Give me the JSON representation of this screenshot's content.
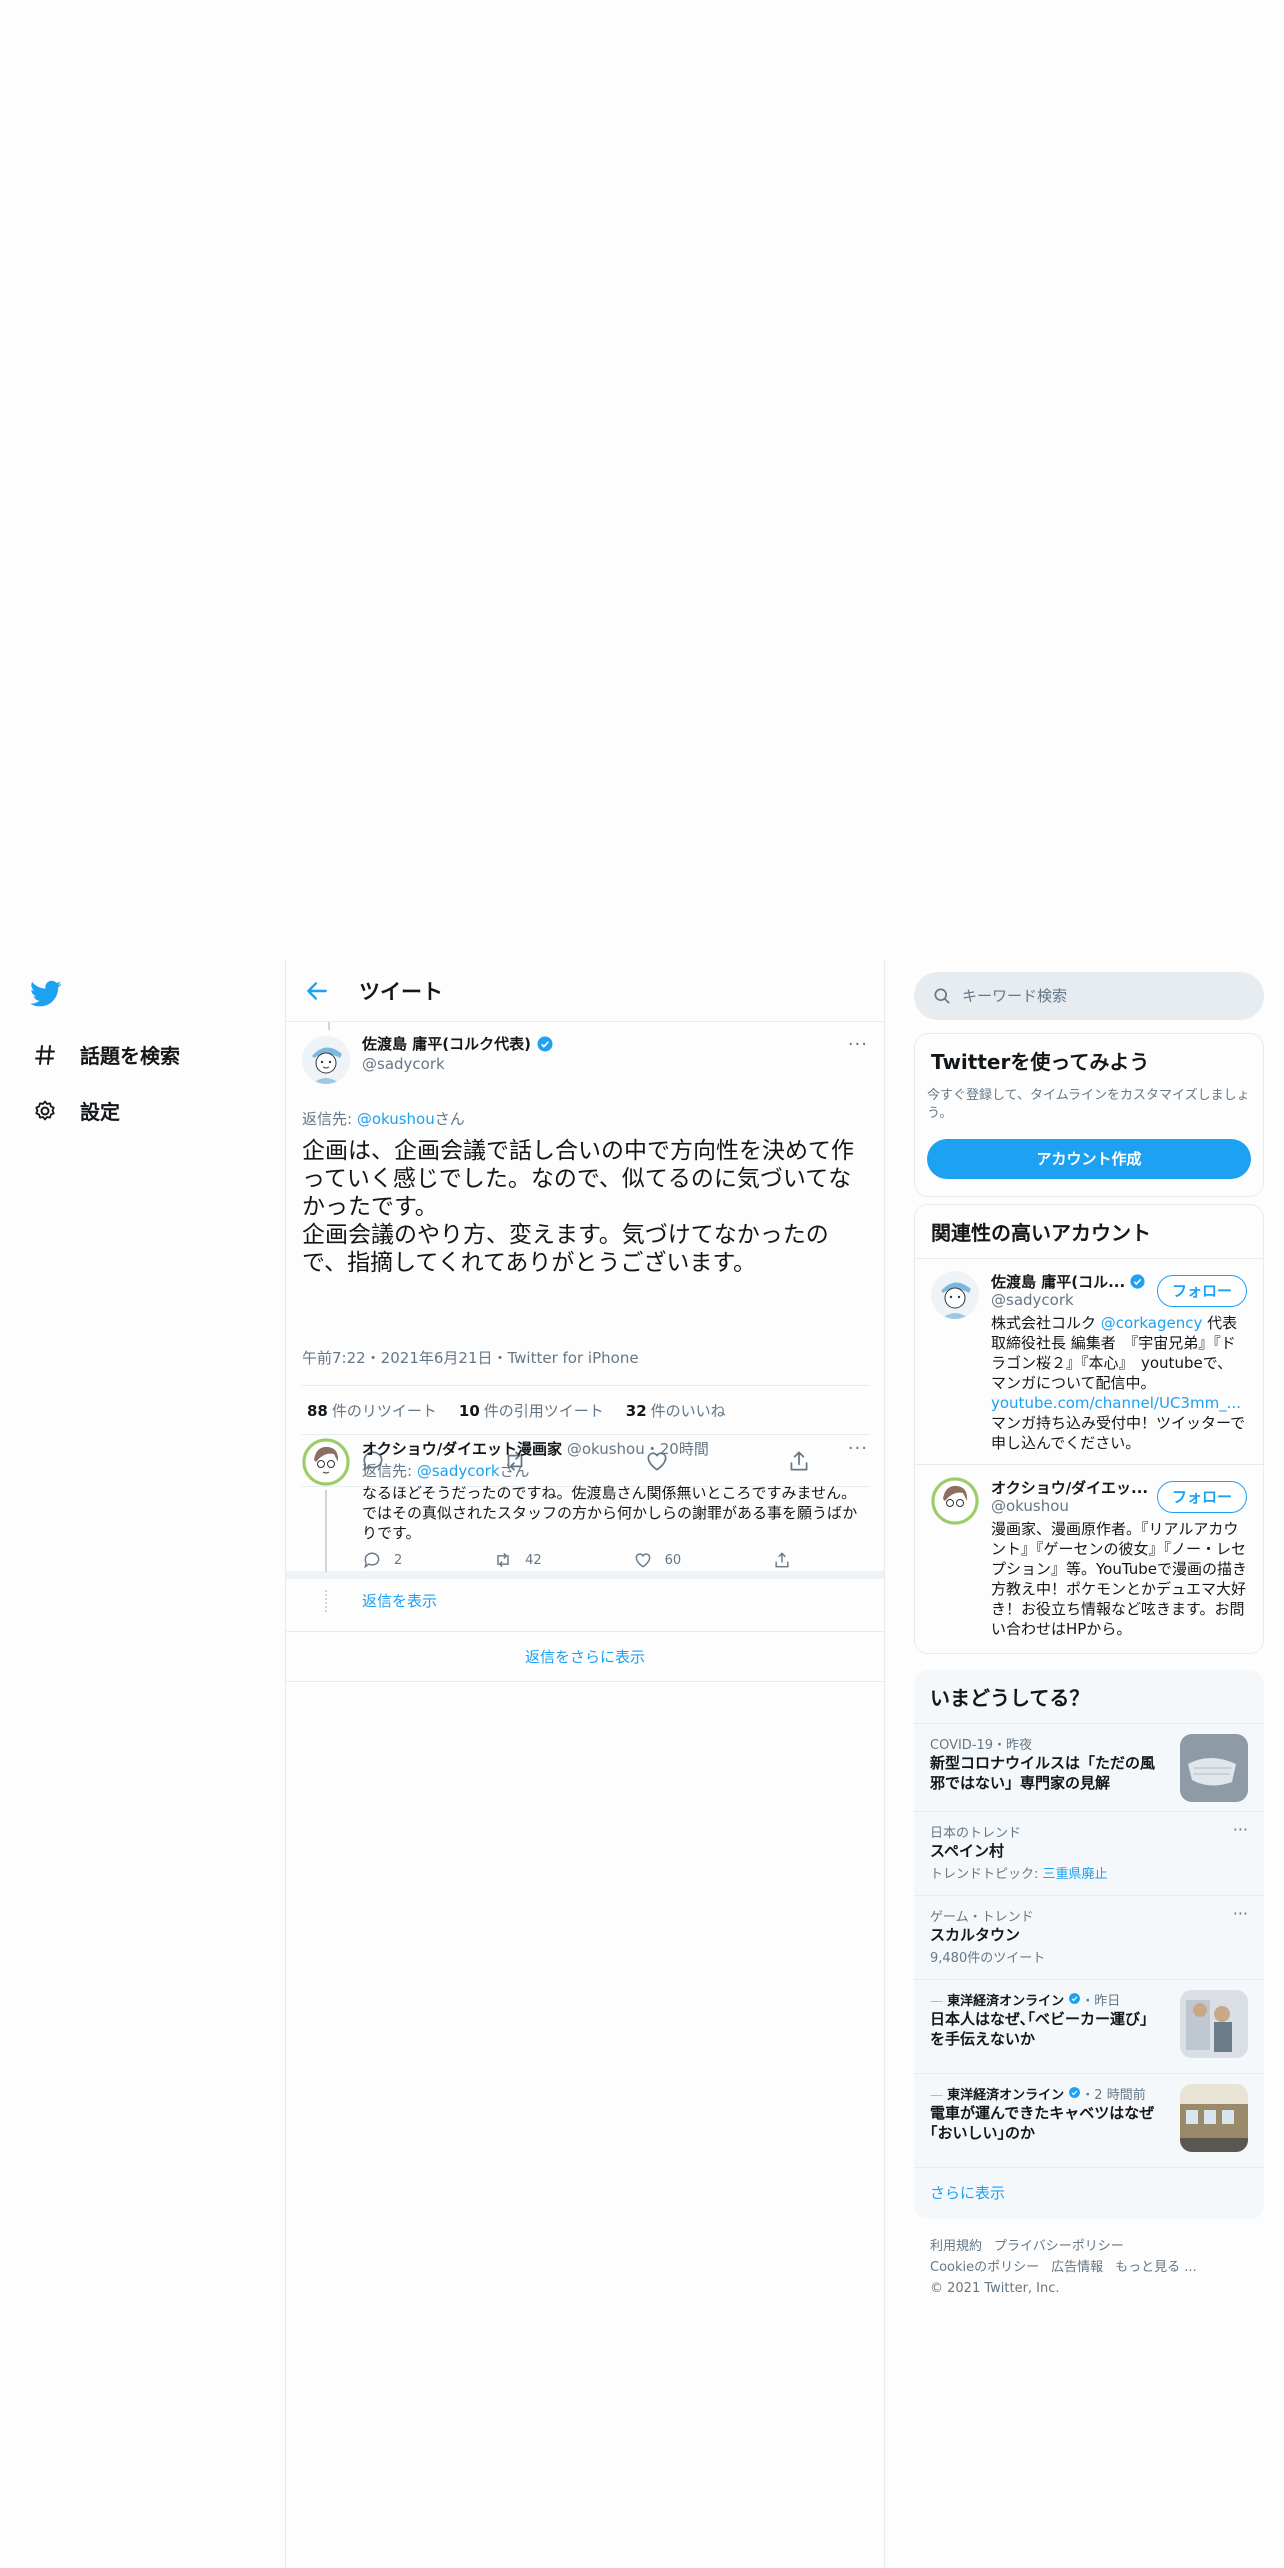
{
  "nav": {
    "explore_label": "話題を検索",
    "settings_label": "設定"
  },
  "header": {
    "title": "ツイート"
  },
  "main_tweet": {
    "name": "佐渡島 庸平(コルク代表)",
    "handle": "@sadycork",
    "reply_prefix": "返信先: ",
    "reply_handle": "@okushou",
    "reply_suffix": "さん",
    "text_line1": "企画は、企画会議で話し合いの中で方向性を決めて作っていく感じでした。なので、似てるのに気づいてなかったです。",
    "text_line2": "企画会議のやり方、変えます。気づけてなかったので、指摘してくれてありがとうございます。",
    "meta": "午前7:22・2021年6月21日・Twitter for iPhone",
    "retweets_count": "88",
    "retweets_label": "件のリツイート",
    "quotes_count": "10",
    "quotes_label": "件の引用ツイート",
    "likes_count": "32",
    "likes_label": "件のいいね"
  },
  "reply": {
    "name": "オクショウ/ダイエット漫画家",
    "handle_time": "@okushou・20時間",
    "reply_prefix": "返信先: ",
    "reply_handle": "@sadycork",
    "reply_suffix": "さん",
    "text": "なるほどそうだったのですね。佐渡島さん関係無いところですみません。ではその真似されたスタッフの方から何かしらの謝罪がある事を願うばかりです。",
    "replies": "2",
    "retweets": "42",
    "likes": "60",
    "show_replies": "返信を表示"
  },
  "show_more_replies": "返信をさらに表示",
  "search": {
    "placeholder": "キーワード検索"
  },
  "signup": {
    "title": "Twitterを使ってみよう",
    "desc": "今すぐ登録して、タイムラインをカスタマイズしましょう。",
    "button": "アカウント作成"
  },
  "related": {
    "title": "関連性の高いアカウント",
    "accounts": [
      {
        "name": "佐渡島 庸平(コル...",
        "handle": "@sadycork",
        "follow": "フォロー",
        "bio_pre": "株式会社コルク ",
        "bio_link": "@corkagency",
        "bio_mid": " 代表取締役社長 編集者　『宇宙兄弟』『ドラゴン桜２』『本心』　youtubeで、マンガについて配信中。",
        "bio_url": "youtube.com/channel/UC3mm_...",
        "bio_post": "マンガ持ち込み受付中！ツイッターで申し込んでください。"
      },
      {
        "name": "オクショウ/ダイエッ...",
        "handle": "@okushou",
        "follow": "フォロー",
        "bio": "漫画家、漫画原作者。『リアルアカウント』『ゲーセンの彼女』『ノー・レセプション』等。YouTubeで漫画の描き方教え中！ポケモンとかデュエマ大好き！お役立ち情報など呟きます。お問い合わせはHPから。"
      }
    ]
  },
  "trends": {
    "title": "いまどうしてる？",
    "items": [
      {
        "meta": "COVID-19・昨夜",
        "title": "新型コロナウイルスは「ただの風邪ではない」専門家の見解"
      },
      {
        "meta": "日本のトレンド",
        "title": "スペイン村",
        "sub_label": "トレンドトピック: ",
        "sub_link": "三重県廃止"
      },
      {
        "meta": "ゲーム・トレンド",
        "title": "スカルタウン",
        "sub": "9,480件のツイート"
      },
      {
        "source": "東洋経済オンライン",
        "time": "・昨日",
        "title": "日本人はなぜ､｢ベビーカー運び｣を手伝えないか"
      },
      {
        "source": "東洋経済オンライン",
        "time": "・2 時間前",
        "title": "電車が運んできたキャベツはなぜ｢おいしい｣のか"
      }
    ],
    "more": "さらに表示"
  },
  "footer": {
    "terms": "利用規約",
    "privacy": "プライバシーポリシー",
    "cookie": "Cookieのポリシー",
    "ads": "広告情報",
    "more": "もっと見る ...",
    "copyright": "© 2021 Twitter, Inc."
  },
  "colors": {
    "accent": "#1da1f2",
    "muted": "#657786",
    "border": "#e6ecf0"
  }
}
